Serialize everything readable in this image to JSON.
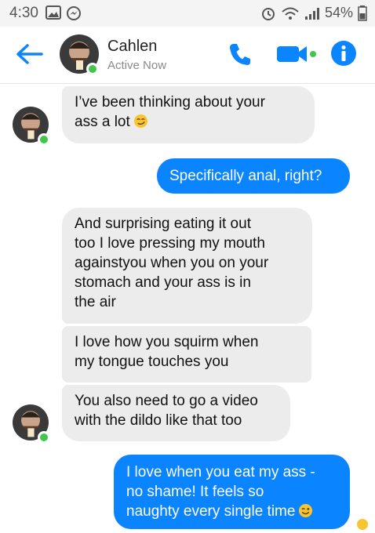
{
  "status_bar": {
    "time": "4:30",
    "battery": "54%",
    "left_icons": [
      "image-icon",
      "messenger-icon"
    ],
    "right_icons": [
      "alarm-icon",
      "wifi-icon",
      "signal-icon",
      "battery-icon"
    ]
  },
  "header": {
    "contact_name": "Cahlen",
    "contact_status": "Active Now",
    "icons": [
      "back-arrow-icon",
      "phone-icon",
      "video-icon",
      "info-icon"
    ],
    "accent_color": "#0a84ff",
    "presence_color": "#41c64b"
  },
  "messages": [
    {
      "direction": "in",
      "lines": [
        "I’ve been thinking about your",
        "ass a lot"
      ],
      "emoji": "smirk-emoji"
    },
    {
      "direction": "out",
      "lines": [
        "Specifically anal, right?"
      ]
    },
    {
      "direction": "in",
      "lines": [
        "And surprising eating it out",
        "too I love pressing my mouth",
        "againstyou when you on your",
        "stomach and your ass is in",
        "the air"
      ]
    },
    {
      "direction": "in",
      "lines": [
        "I love how you squirm when",
        "my tongue touches you"
      ]
    },
    {
      "direction": "in",
      "lines": [
        "You also need to go a video",
        "with the dildo like that too"
      ]
    },
    {
      "direction": "out",
      "lines": [
        "I love when you eat my ass -",
        "no shame! It feels so",
        "naughty every single time"
      ],
      "emoji": "wink-emoji"
    }
  ]
}
